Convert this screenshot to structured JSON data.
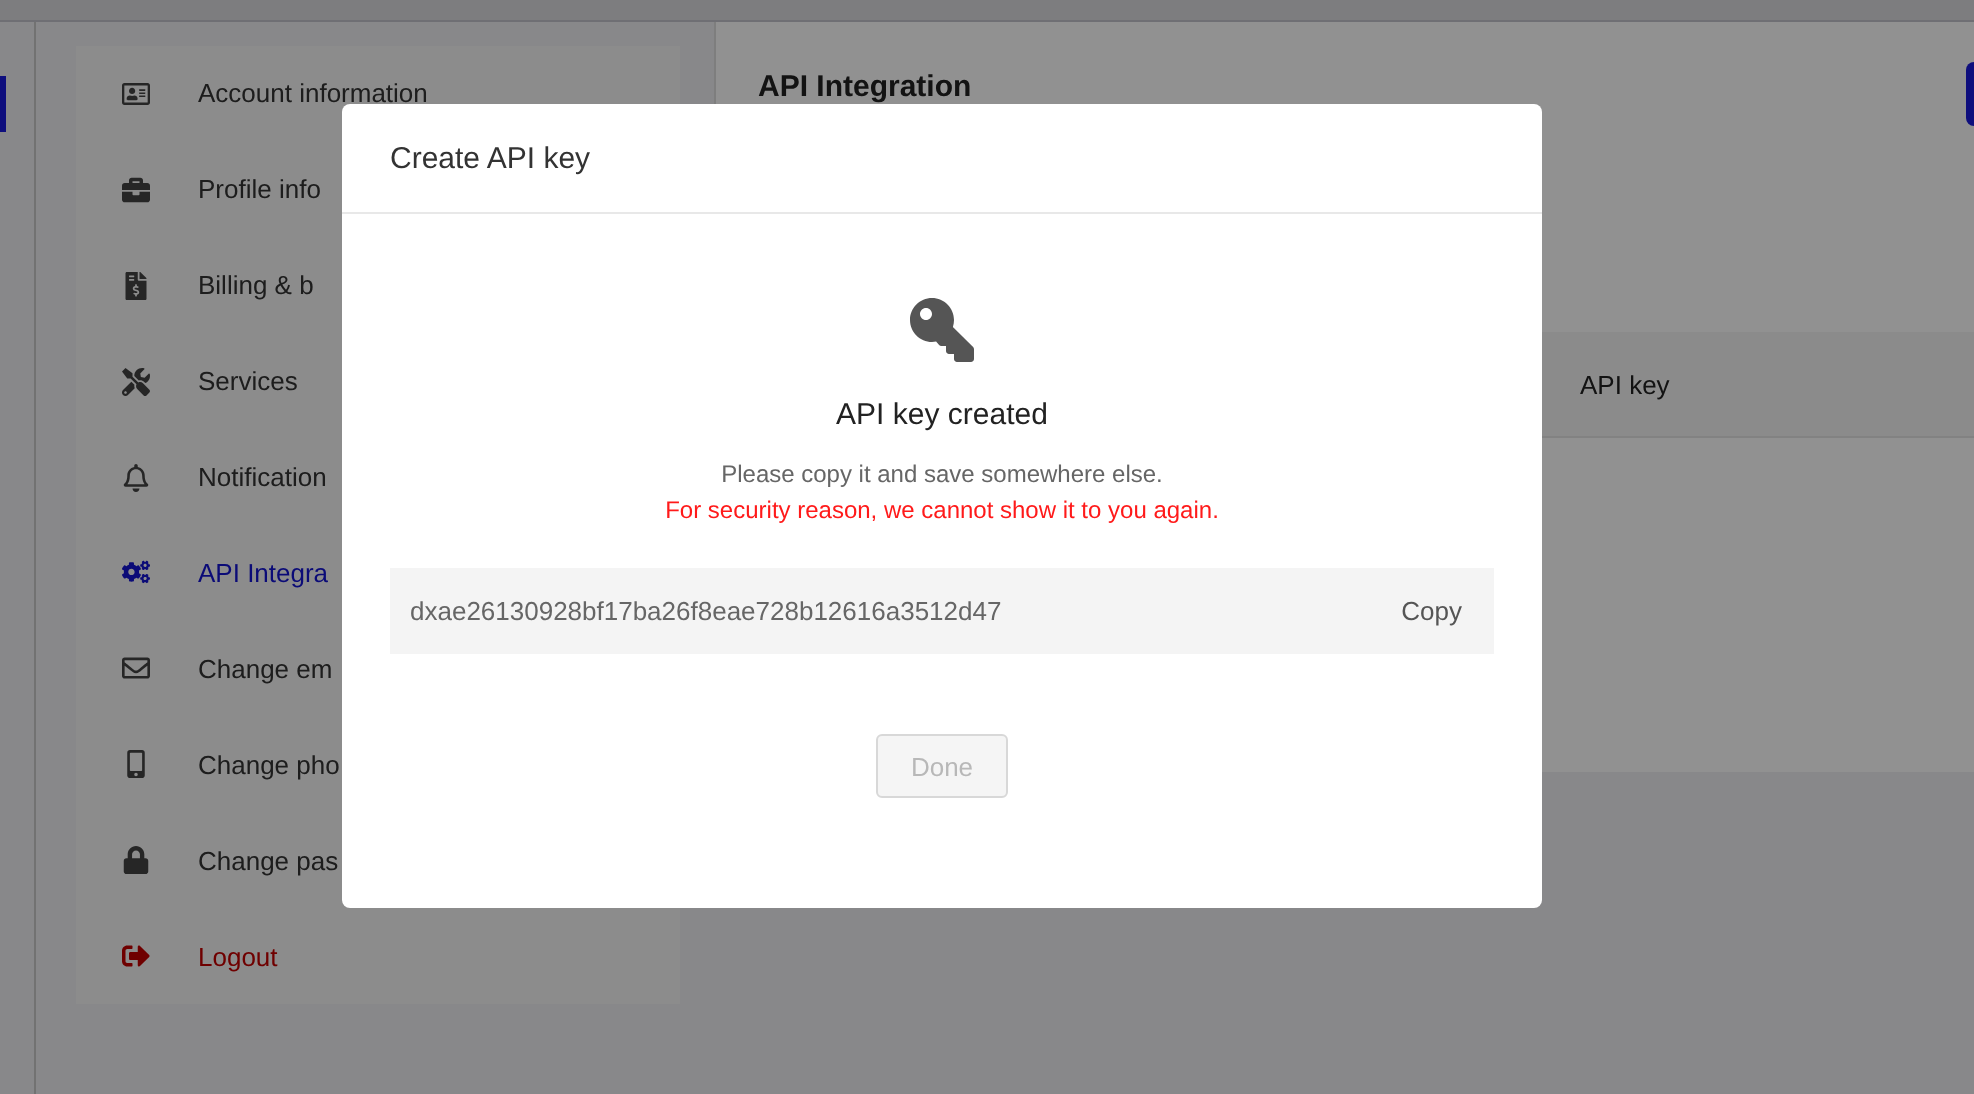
{
  "sidebar": {
    "items": [
      {
        "label": "Account information",
        "kind": "nav",
        "selected": false
      },
      {
        "label": "Profile info",
        "kind": "nav",
        "selected": false
      },
      {
        "label": "Billing & b",
        "kind": "nav",
        "selected": false
      },
      {
        "label": "Services",
        "kind": "nav",
        "selected": false
      },
      {
        "label": "Notification",
        "kind": "nav",
        "selected": false
      },
      {
        "label": "API Integra",
        "kind": "nav",
        "selected": true
      },
      {
        "label": "Change em",
        "kind": "nav",
        "selected": false
      },
      {
        "label": "Change pho",
        "kind": "nav",
        "selected": false
      },
      {
        "label": "Change pas",
        "kind": "nav",
        "selected": false
      },
      {
        "label": "Logout",
        "kind": "logout",
        "selected": false
      }
    ]
  },
  "main": {
    "title": "API Integration",
    "table": {
      "columns": [
        "API key"
      ]
    }
  },
  "dialog": {
    "title": "Create API key",
    "heading": "API key created",
    "message": "Please copy it and save somewhere else.",
    "warning": "For security reason, we cannot show it to you again.",
    "api_key": "dxae26130928bf17ba26f8eae728b12616a3512d47",
    "copy_label": "Copy",
    "done": {
      "label": "Done",
      "disabled": true
    }
  }
}
